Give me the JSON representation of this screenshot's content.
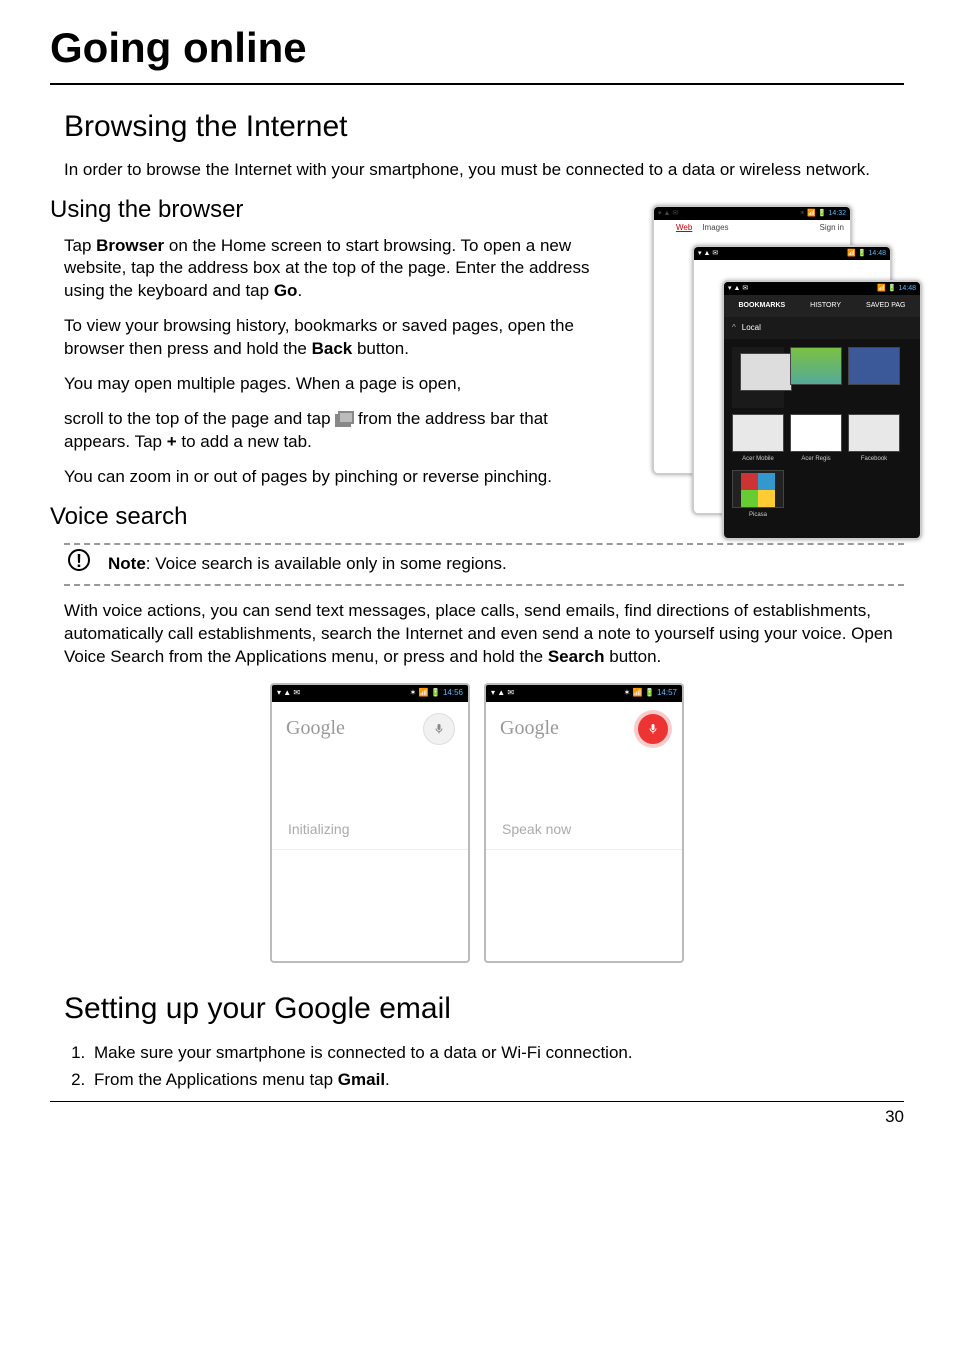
{
  "title": "Going online",
  "s1": {
    "heading": "Browsing the Internet",
    "intro": "In order to browse the Internet with your smartphone, you must be connected to a data or wireless network.",
    "sub1": {
      "heading": "Using the browser",
      "p1a": "Tap ",
      "p1b": "Browser",
      "p1c": " on the Home screen to start browsing. To open a new website, tap the address box at the top of the page. Enter the address using the keyboard and tap ",
      "p1d": "Go",
      "p1e": ".",
      "p2a": "To view your browsing history, bookmarks or saved pages, open the browser then press and hold the ",
      "p2b": "Back",
      "p2c": " button.",
      "p3": "You may open multiple pages. When a page is open,",
      "p4a": "scroll to the top of the page and tap ",
      "p4b": " from the address bar that appears. Tap ",
      "p4c": "+",
      "p4d": " to add a new tab.",
      "p5": "You can zoom in or out of pages by pinching or reverse pinching."
    },
    "sub2": {
      "heading": "Voice search",
      "note_b": "Note",
      "note": ": Voice search is available only in some regions.",
      "p1a": "With voice actions, you can send text messages, place calls, send emails, find directions of establishments, automatically call establishments, search the Internet and even send a note to yourself using your voice. Open Voice Search from the Applications menu, or press and hold the ",
      "p1b": "Search",
      "p1c": " button."
    }
  },
  "s2": {
    "heading": "Setting up your Google email",
    "li1": "Make sure your smartphone is connected to a data or Wi-Fi connection.",
    "li2a": "From the Applications menu tap ",
    "li2b": "Gmail",
    "li2c": "."
  },
  "shots": {
    "p1": {
      "time": "14:32",
      "web": "Web",
      "images": "Images",
      "signin": "Sign in"
    },
    "p2": {
      "time": "14:48"
    },
    "p3": {
      "time": "14:48",
      "tabs": {
        "bookmarks": "BOOKMARKS",
        "history": "HISTORY",
        "saved": "SAVED PAG"
      },
      "local": "Local",
      "items": {
        "acer": "Acer Mobile",
        "reg": "Acer Regis",
        "fb": "Facebook",
        "picasa": "Picasa"
      }
    },
    "v": {
      "logo": "Google",
      "t1": "14:56",
      "s1": "Initializing",
      "t2": "14:57",
      "s2": "Speak now"
    }
  },
  "pagenum": "30"
}
